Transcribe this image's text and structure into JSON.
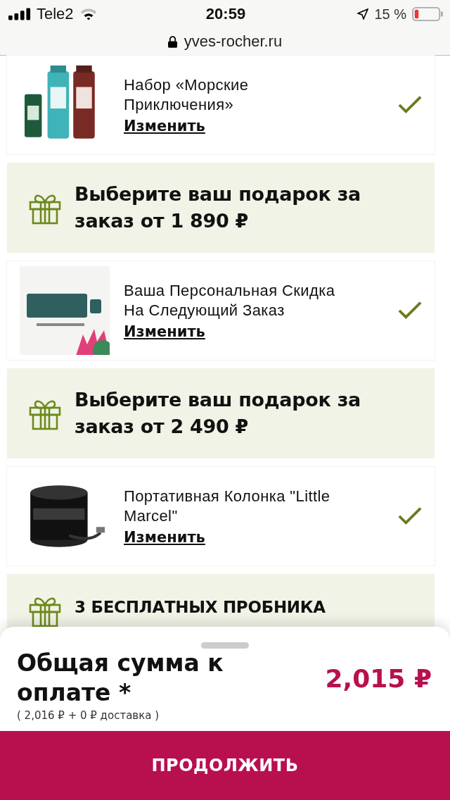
{
  "status_bar": {
    "carrier": "Tele2",
    "time": "20:59",
    "battery_percent": "15 %"
  },
  "address_bar": {
    "url": "yves-rocher.ru"
  },
  "sections": [
    {
      "kind": "item",
      "name": "Набор «Морские Приключения»",
      "action": "Изменить",
      "checked": true
    },
    {
      "kind": "header",
      "title": "Выберите ваш подарок за заказ от 1 890 ₽"
    },
    {
      "kind": "item",
      "name": "Ваша Персональная Скидка На Следующий Заказ",
      "action": "Изменить",
      "checked": true
    },
    {
      "kind": "header",
      "title": "Выберите ваш подарок за заказ от 2 490 ₽"
    },
    {
      "kind": "item",
      "name": "Портативная Колонка \"Little Marcel\"",
      "action": "Изменить",
      "checked": true
    },
    {
      "kind": "header",
      "title": "3 БЕСПЛАТНЫХ ПРОБНИКА"
    }
  ],
  "summary": {
    "title": "Общая сумма к оплате *",
    "total": "2,015 ₽",
    "breakdown": "( 2,016 ₽ + 0 ₽ доставка )",
    "button": "ПРОДОЛЖИТЬ"
  }
}
